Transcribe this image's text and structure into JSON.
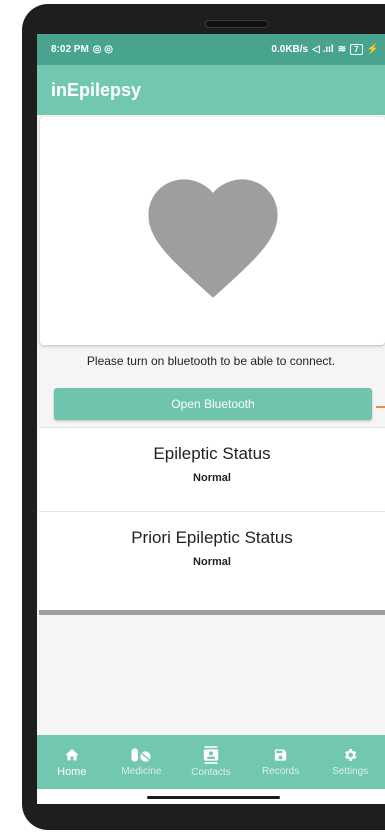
{
  "status_bar": {
    "time": "8:02 PM",
    "net_speed": "0.0KB/s",
    "battery": "7"
  },
  "app_bar": {
    "title": "inEpilepsy"
  },
  "bluetooth": {
    "message": "Please turn on bluetooth to be able to connect.",
    "button_label": "Open Bluetooth"
  },
  "epileptic_status": {
    "title": "Epileptic Status",
    "value": "Normal"
  },
  "priori_status": {
    "title": "Priori Epileptic Status",
    "value": "Normal"
  },
  "nav": {
    "items": [
      {
        "label": "Home",
        "icon": "home-icon",
        "active": true
      },
      {
        "label": "Medicine",
        "icon": "pills-icon"
      },
      {
        "label": "Contacts",
        "icon": "contacts-icon"
      },
      {
        "label": "Records",
        "icon": "save-icon"
      },
      {
        "label": "Settings",
        "icon": "gear-icon"
      }
    ]
  },
  "colors": {
    "primary": "#72c7b0",
    "status_bar": "#48a48e",
    "heart": "#9e9e9e",
    "accent_orange": "#ef8a3b"
  }
}
